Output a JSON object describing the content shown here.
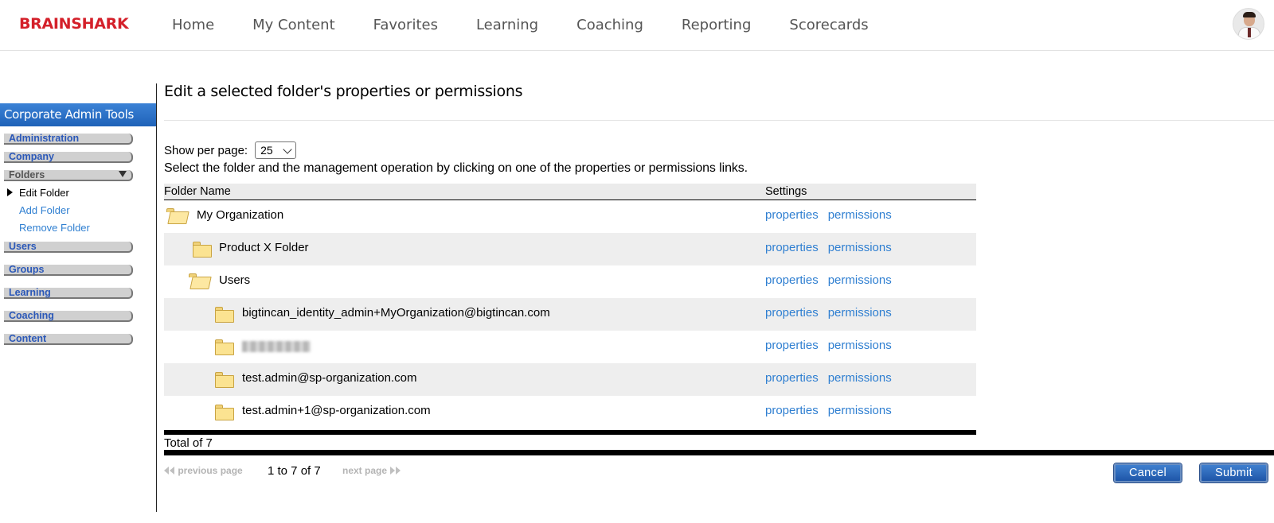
{
  "brand": {
    "logo_text": "BRAINSHARK",
    "logo_color": "#d4202a"
  },
  "nav": {
    "items": [
      "Home",
      "My Content",
      "Favorites",
      "Learning",
      "Coaching",
      "Reporting",
      "Scorecards"
    ]
  },
  "sidebar": {
    "header": "Corporate Admin Tools",
    "groups": {
      "administration": "Administration",
      "company": "Company",
      "folders": "Folders",
      "users": "Users",
      "groups": "Groups",
      "learning": "Learning",
      "coaching": "Coaching",
      "content": "Content"
    },
    "folder_items": {
      "edit": "Edit Folder",
      "add": "Add Folder",
      "remove": "Remove Folder"
    }
  },
  "main": {
    "title": "Edit a selected folder's properties or permissions",
    "per_page_label": "Show per page:",
    "per_page_value": "25",
    "instructions": "Select the folder and the management operation by clicking on one of the properties or permissions links.",
    "columns": {
      "name": "Folder Name",
      "settings": "Settings"
    },
    "rows": [
      {
        "name": "My Organization"
      },
      {
        "name": "Product X Folder"
      },
      {
        "name": "Users"
      },
      {
        "name": "bigtincan_identity_admin+MyOrganization@bigtincan.com"
      },
      {
        "name": ""
      },
      {
        "name": "test.admin@sp-organization.com"
      },
      {
        "name": "test.admin+1@sp-organization.com"
      }
    ],
    "link_properties": "properties",
    "link_permissions": "permissions",
    "total": "Total of 7"
  },
  "pager": {
    "previous": "previous page",
    "next": "next page",
    "range": "1 to 7 of 7"
  },
  "buttons": {
    "cancel": "Cancel",
    "submit": "Submit"
  },
  "colors": {
    "link": "#2f7fd1",
    "sidebar_header": "#2a6fc6",
    "button": "#2a62b4"
  }
}
